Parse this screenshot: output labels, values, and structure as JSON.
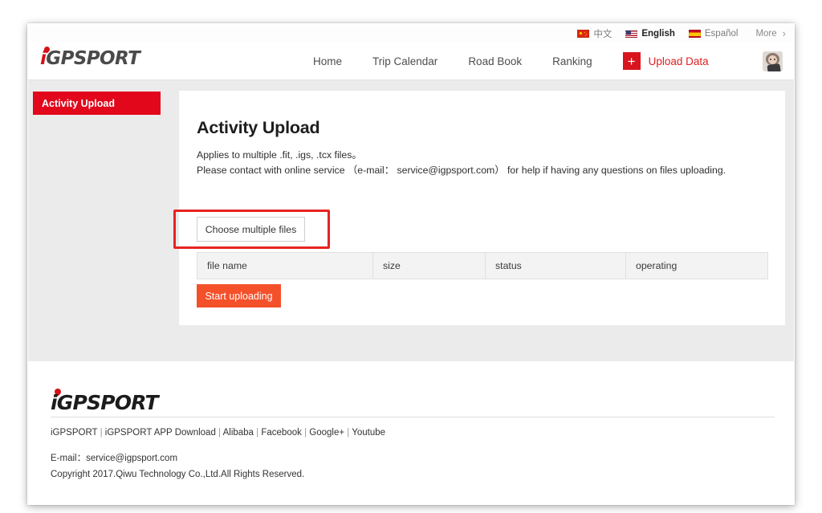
{
  "language_bar": {
    "items": [
      {
        "label": "中文",
        "flag": "flag-cn-icon",
        "active": false
      },
      {
        "label": "English",
        "flag": "flag-us-icon",
        "active": true
      },
      {
        "label": "Español",
        "flag": "flag-es-icon",
        "active": false
      }
    ],
    "more_label": "More",
    "more_chevron": "›"
  },
  "header": {
    "brand": {
      "initial": "i",
      "rest": "GPSPORT"
    },
    "nav": [
      {
        "label": "Home"
      },
      {
        "label": "Trip Calendar"
      },
      {
        "label": "Road Book"
      },
      {
        "label": "Ranking"
      }
    ],
    "upload": {
      "plus_glyph": "+",
      "label": "Upload Data"
    },
    "avatar_name": "user-avatar"
  },
  "sidebar": {
    "items": [
      {
        "label": "Activity Upload",
        "active": true
      }
    ]
  },
  "main": {
    "title": "Activity Upload",
    "description_line_1": "Applies to multiple .fit, .igs, .tcx files。",
    "description_line_2": "Please contact with online service （e-mail： service@igpsport.com） for help if having any questions on files uploading.",
    "choose_files_label": "Choose multiple files",
    "start_uploading_label": "Start uploading",
    "table": {
      "columns": [
        "file name",
        "size",
        "status",
        "operating"
      ],
      "rows": []
    }
  },
  "footer": {
    "brand": {
      "initial": "i",
      "rest": "GPSPORT"
    },
    "links": [
      "iGPSPORT",
      "iGPSPORT APP Download",
      "Alibaba",
      "Facebook",
      "Google+",
      "Youtube"
    ],
    "separator": " | ",
    "email": "E-mail：service@igpsport.com",
    "copyright": "Copyright 2017.Qiwu Technology Co.,Ltd.All Rights Reserved."
  },
  "colors": {
    "brand_red": "#d31118",
    "nav_upload_red": "#e02020",
    "sidebar_red": "#e2071b",
    "start_button_orange": "#f4502a",
    "annotation_red": "#e8231f",
    "content_band_gray": "#ebebeb"
  }
}
